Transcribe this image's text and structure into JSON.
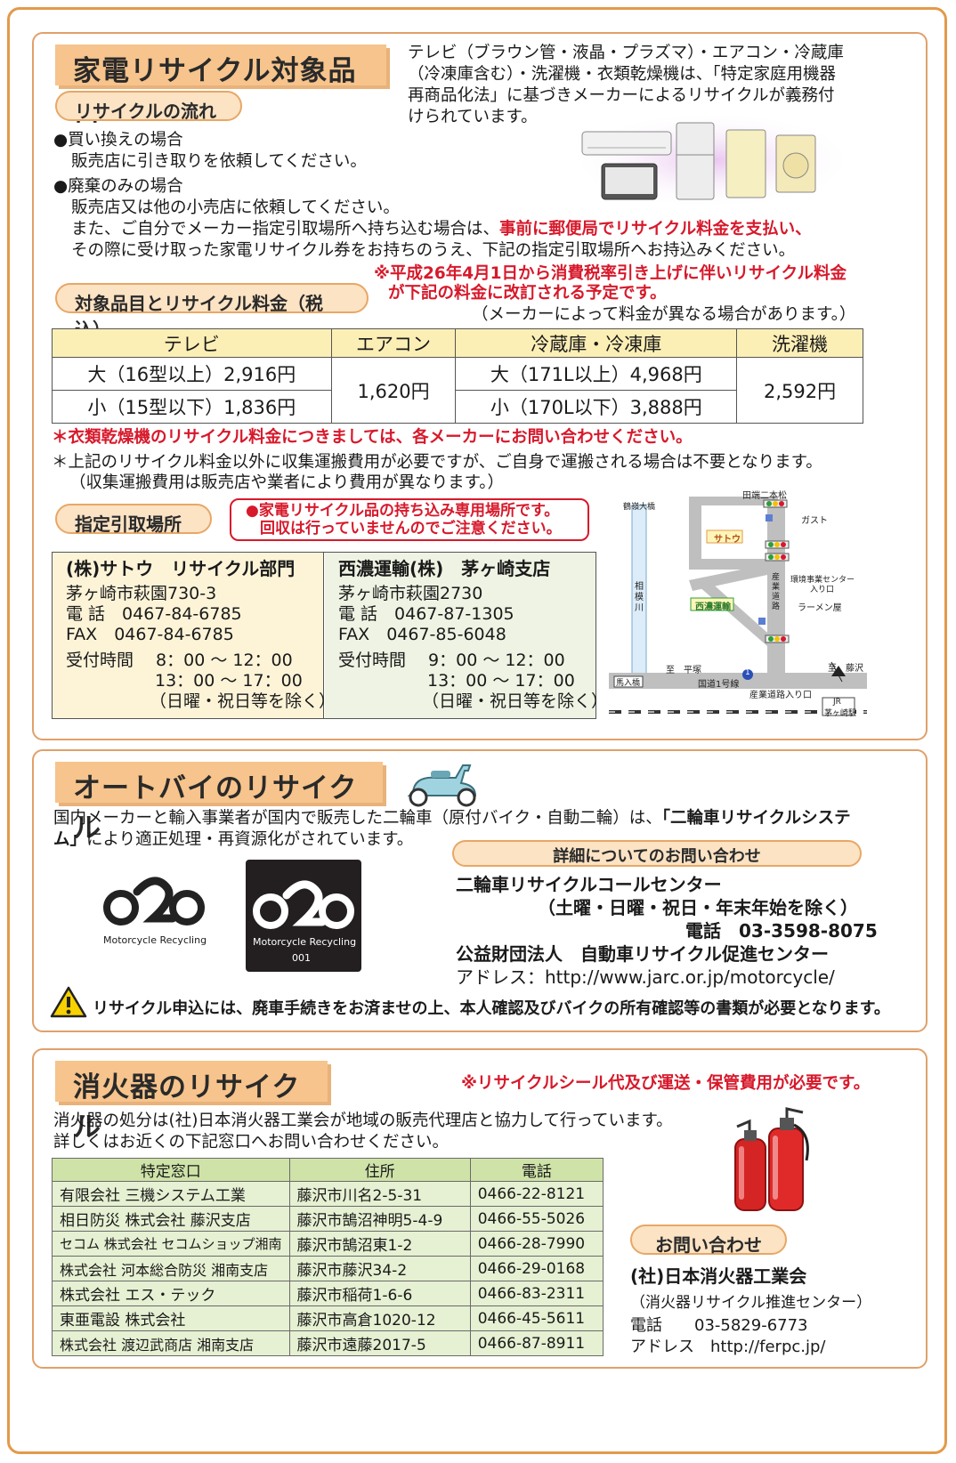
{
  "appliance": {
    "title": "家電リサイクル対象品目",
    "intro": [
      "テレビ（ブラウン管・液晶・プラズマ）・エアコン・冷蔵庫",
      "（冷凍庫含む）・洗濯機・衣類乾燥機は、「特定家庭用機器",
      "再商品化法」に基づきメーカーによるリサイクルが義務付",
      "けられています。"
    ],
    "flow_label": "リサイクルの流れ",
    "buy_head": "●買い換えの場合",
    "buy_text": "販売店に引き取りを依頼してください。",
    "disposal_head": "●廃棄のみの場合",
    "disposal_text1": "販売店又は他の小売店に依頼してください。",
    "disposal_text2_a": "また、ご自分でメーカー指定引取場所へ持ち込む場合は、",
    "disposal_text2_red": "事前に郵便局でリサイクル料金を支払い、",
    "disposal_text3": "その際に受け取った家電リサイクル券をお持ちのうえ、下記の指定引取場所へお持込みください。",
    "tax_note1": "※平成26年4月1日から消費税率引き上げに伴いリサイクル料金",
    "tax_note2": "が下記の料金に改訂される予定です。",
    "maker_note": "（メーカーによって料金が異なる場合があります。）",
    "fee_label": "対象品目とリサイクル料金（税込）",
    "fee_table": {
      "headers": [
        "テレビ",
        "エアコン",
        "冷蔵庫・冷凍庫",
        "洗濯機"
      ],
      "tv_large": "大（16型以上）2,916円",
      "tv_small": "小（15型以下）1,836円",
      "aircon": "1,620円",
      "fridge_large": "大（171L以上）4,968円",
      "fridge_small": "小（170L以下）3,888円",
      "washer": "2,592円"
    },
    "dryer_note": "＊衣類乾燥機のリサイクル料金につきましては、各メーカーにお問い合わせください。",
    "transport_note1": "＊上記のリサイクル料金以外に収集運搬費用が必要ですが、ご自身で運搬される場合は不要となります。",
    "transport_note2": "（収集運搬費用は販売店や業者により費用が異なります。）",
    "site_label": "指定引取場所",
    "warning1": "●家電リサイクル品の持ち込み専用場所です。",
    "warning2": "回収は行っていませんのでご注意ください。",
    "sites": [
      {
        "name": "(株)サトウ　リサイクル部門",
        "address": "茅ヶ崎市萩園730-3",
        "tel": "電 話　0467-84-6785",
        "fax": "FAX　0467-84-6785",
        "hours1": "受付時間　 8：00 ～ 12：00",
        "hours2": "13：00 ～ 17：00",
        "hours3": "（日曜・祝日等を除く）"
      },
      {
        "name": "西濃運輸(株)　茅ヶ崎支店",
        "address": "茅ヶ崎市萩園2730",
        "tel": "電 話　0467-87-1305",
        "fax": "FAX　0467-85-6048",
        "hours1": "受付時間　 9：00 ～ 12：00",
        "hours2": "13：00 ～ 17：00",
        "hours3": "（日曜・祝日等を除く）"
      }
    ],
    "map": {
      "tagasaki": "田端二本松",
      "gust": "ガスト",
      "sato": "サトウ",
      "kankyo1": "環境事業センター",
      "kankyo2": "入り口",
      "sagami": "相模川",
      "tsurumine": "鶴嶺大橋",
      "seino": "西濃運輸",
      "ramen": "ラーメン屋",
      "sangyo_road": "産業道路",
      "hirastuka": "至　平塚",
      "fujisawa": "至　藤沢",
      "banyu": "馬入橋",
      "route1": "国道1号線",
      "sangyo_entrance": "産業道路入り口",
      "jr1": "JR",
      "jr2": "茅ヶ崎駅",
      "route_num": "1"
    }
  },
  "motorcycle": {
    "title": "オートバイのリサイクル",
    "text1_a": "国内メーカーと輸入事業者が国内で販売した二輪車（原付バイク・自動二輪）は、",
    "text1_b": "「二輪車リサイクルシステ",
    "text2_a": "ム」",
    "text2_b": "により適正処理・再資源化がされています。",
    "logo_text": "Motorcycle Recycling",
    "logo_num": "001",
    "contact_label": "詳細についてのお問い合わせ",
    "center_name": "二輪車リサイクルコールセンター",
    "center_hours": "（土曜・日曜・祝日・年末年始を除く）",
    "center_tel": "電話　03-3598-8075",
    "foundation": "公益財団法人　自動車リサイクル促進センター",
    "address": "アドレス：http://www.jarc.or.jp/motorcycle/",
    "caution": "リサイクル申込には、廃車手続きをお済ませの上、本人確認及びバイクの所有確認等の書類が必要となります。"
  },
  "extinguisher": {
    "title": "消火器のリサイクル",
    "cost_note": "※リサイクルシール代及び運送・保管費用が必要です。",
    "text1": "消火器の処分は(社)日本消火器工業会が地域の販売代理店と協力して行っています。",
    "text2": "詳しくはお近くの下記窓口へお問い合わせください。",
    "table_headers": [
      "特定窓口",
      "住所",
      "電話"
    ],
    "rows": [
      [
        "有限会社 三機システム工業",
        "藤沢市川名2-5-31",
        "0466-22-8121"
      ],
      [
        "相日防災 株式会社 藤沢支店",
        "藤沢市鵠沼神明5-4-9",
        "0466-55-5026"
      ],
      [
        "セコム 株式会社 セコムショップ湘南",
        "藤沢市鵠沼東1-2",
        "0466-28-7990"
      ],
      [
        "株式会社 河本総合防災 湘南支店",
        "藤沢市藤沢34-2",
        "0466-29-0168"
      ],
      [
        "株式会社 エス・テック",
        "藤沢市稲荷1-6-6",
        "0466-83-2311"
      ],
      [
        "東亜電設 株式会社",
        "藤沢市高倉1020-12",
        "0466-45-5611"
      ],
      [
        "株式会社 渡辺武商店 湘南支店",
        "藤沢市遠藤2017-5",
        "0466-87-8911"
      ]
    ],
    "contact_label": "お問い合わせ",
    "org": "(社)日本消火器工業会",
    "org_sub": "（消火器リサイクル推進センター）",
    "tel": "電話　　03-5829-6773",
    "url": "アドレス　http://ferpc.jp/"
  },
  "colors": {
    "accent_orange": "#f6c48c",
    "border_orange": "#e0a06a",
    "alert_red": "#d7192b",
    "table_yellow": "#fcefb6",
    "table_green": "#e6f0d2"
  }
}
